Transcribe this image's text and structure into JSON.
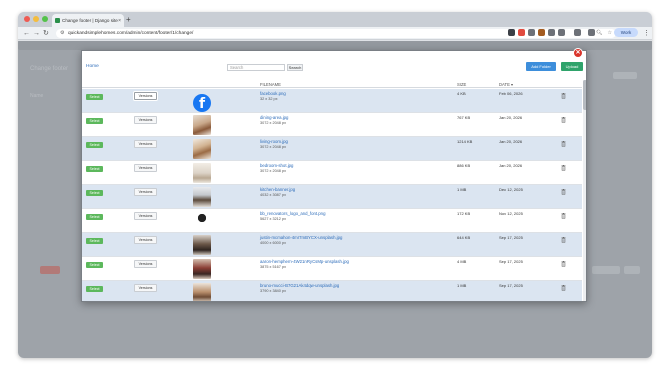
{
  "browser": {
    "tab_title": "Change footer | Django site admin",
    "tab_close": "×",
    "new_tab": "+",
    "url": "quickandsimplehomes.com/admin/content/footer/1/change/",
    "profile_label": "Work",
    "menu_icon": "⋮"
  },
  "page_ghost": {
    "heading": "Change footer",
    "left_label": "Name"
  },
  "modal": {
    "home_label": "Home",
    "search_placeholder": "Search",
    "search_button": "Search",
    "add_folder_button": "Add Folder",
    "upload_button": "Upload",
    "columns": {
      "filename": "FILENAME",
      "size": "SIZE",
      "date": "DATE ▾"
    },
    "select_label": "Select",
    "versions_label": "Versions",
    "close_icon": "✕"
  },
  "rows": [
    {
      "name": "facebook.png",
      "dims": "32 x 32 px",
      "size": "4 KB",
      "date": "Feb 06, 2026",
      "thumb": "facebook-logo"
    },
    {
      "name": "dining-area.jpg",
      "dims": "3072 x 2048 px",
      "size": "767 KB",
      "date": "Jan 20, 2026",
      "thumb": "dining-photo"
    },
    {
      "name": "living-room.jpg",
      "dims": "3072 x 2048 px",
      "size": "1214 KB",
      "date": "Jan 20, 2026",
      "thumb": "living-photo"
    },
    {
      "name": "bedroom-shot.jpg",
      "dims": "3072 x 2048 px",
      "size": "886 KB",
      "date": "Jan 20, 2026",
      "thumb": "bedroom-photo"
    },
    {
      "name": "kitchen-banner.jpg",
      "dims": "4032 x 3087 px",
      "size": "1 MB",
      "date": "Dec 12, 2025",
      "thumb": "kitchen-photo"
    },
    {
      "name": "bb_renovators_logo_and_font.png",
      "dims": "5627 x 3212 px",
      "size": "172 KB",
      "date": "Nov 12, 2025",
      "thumb": "logo-image"
    },
    {
      "name": "justin-mcmahon-4mr7mBYCX-unsplash.jpg",
      "dims": "4000 x 6000 px",
      "size": "644 KB",
      "date": "Sep 17, 2025",
      "thumb": "portrait-man"
    },
    {
      "name": "aaron-hemphern-4W21nRyCsMp-unsplash.jpg",
      "dims": "3875 x 5167 px",
      "size": "4 MB",
      "date": "Sep 17, 2025",
      "thumb": "portrait-woman"
    },
    {
      "name": "bruno-mucci-B7G21Ak4dqw-unsplash.jpg",
      "dims": "3790 x 3840 px",
      "size": "1 MB",
      "date": "Sep 17, 2025",
      "thumb": "portrait-person"
    }
  ],
  "colors": {
    "select_green": "#5cb85c",
    "add_blue": "#3d8edb",
    "upload_green": "#2fa36b",
    "row_alt": "#dbe5f1",
    "link": "#2e6dba"
  }
}
